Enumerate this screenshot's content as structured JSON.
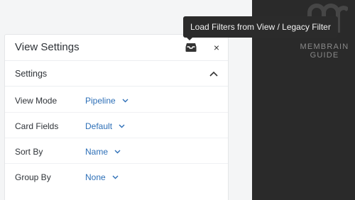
{
  "tooltip": {
    "text": "Load Filters from View / Legacy Filter"
  },
  "brand": {
    "line1": "MEMBRAIN",
    "line2": "GUIDE",
    "logo_icon": "membrain-logo-icon"
  },
  "panel": {
    "title": "View Settings",
    "load_icon": "inbox-tray-icon",
    "close_label": "×",
    "section": {
      "title": "Settings",
      "toggle_icon": "chevron-up-icon"
    },
    "rows": [
      {
        "label": "View Mode",
        "value": "Pipeline"
      },
      {
        "label": "Card Fields",
        "value": "Default"
      },
      {
        "label": "Sort By",
        "value": "Name"
      },
      {
        "label": "Group By",
        "value": "None"
      }
    ]
  },
  "colors": {
    "accent": "#2d6fb7",
    "dark_bg": "#2a2a2a",
    "tooltip_bg": "#2b2b2b"
  }
}
